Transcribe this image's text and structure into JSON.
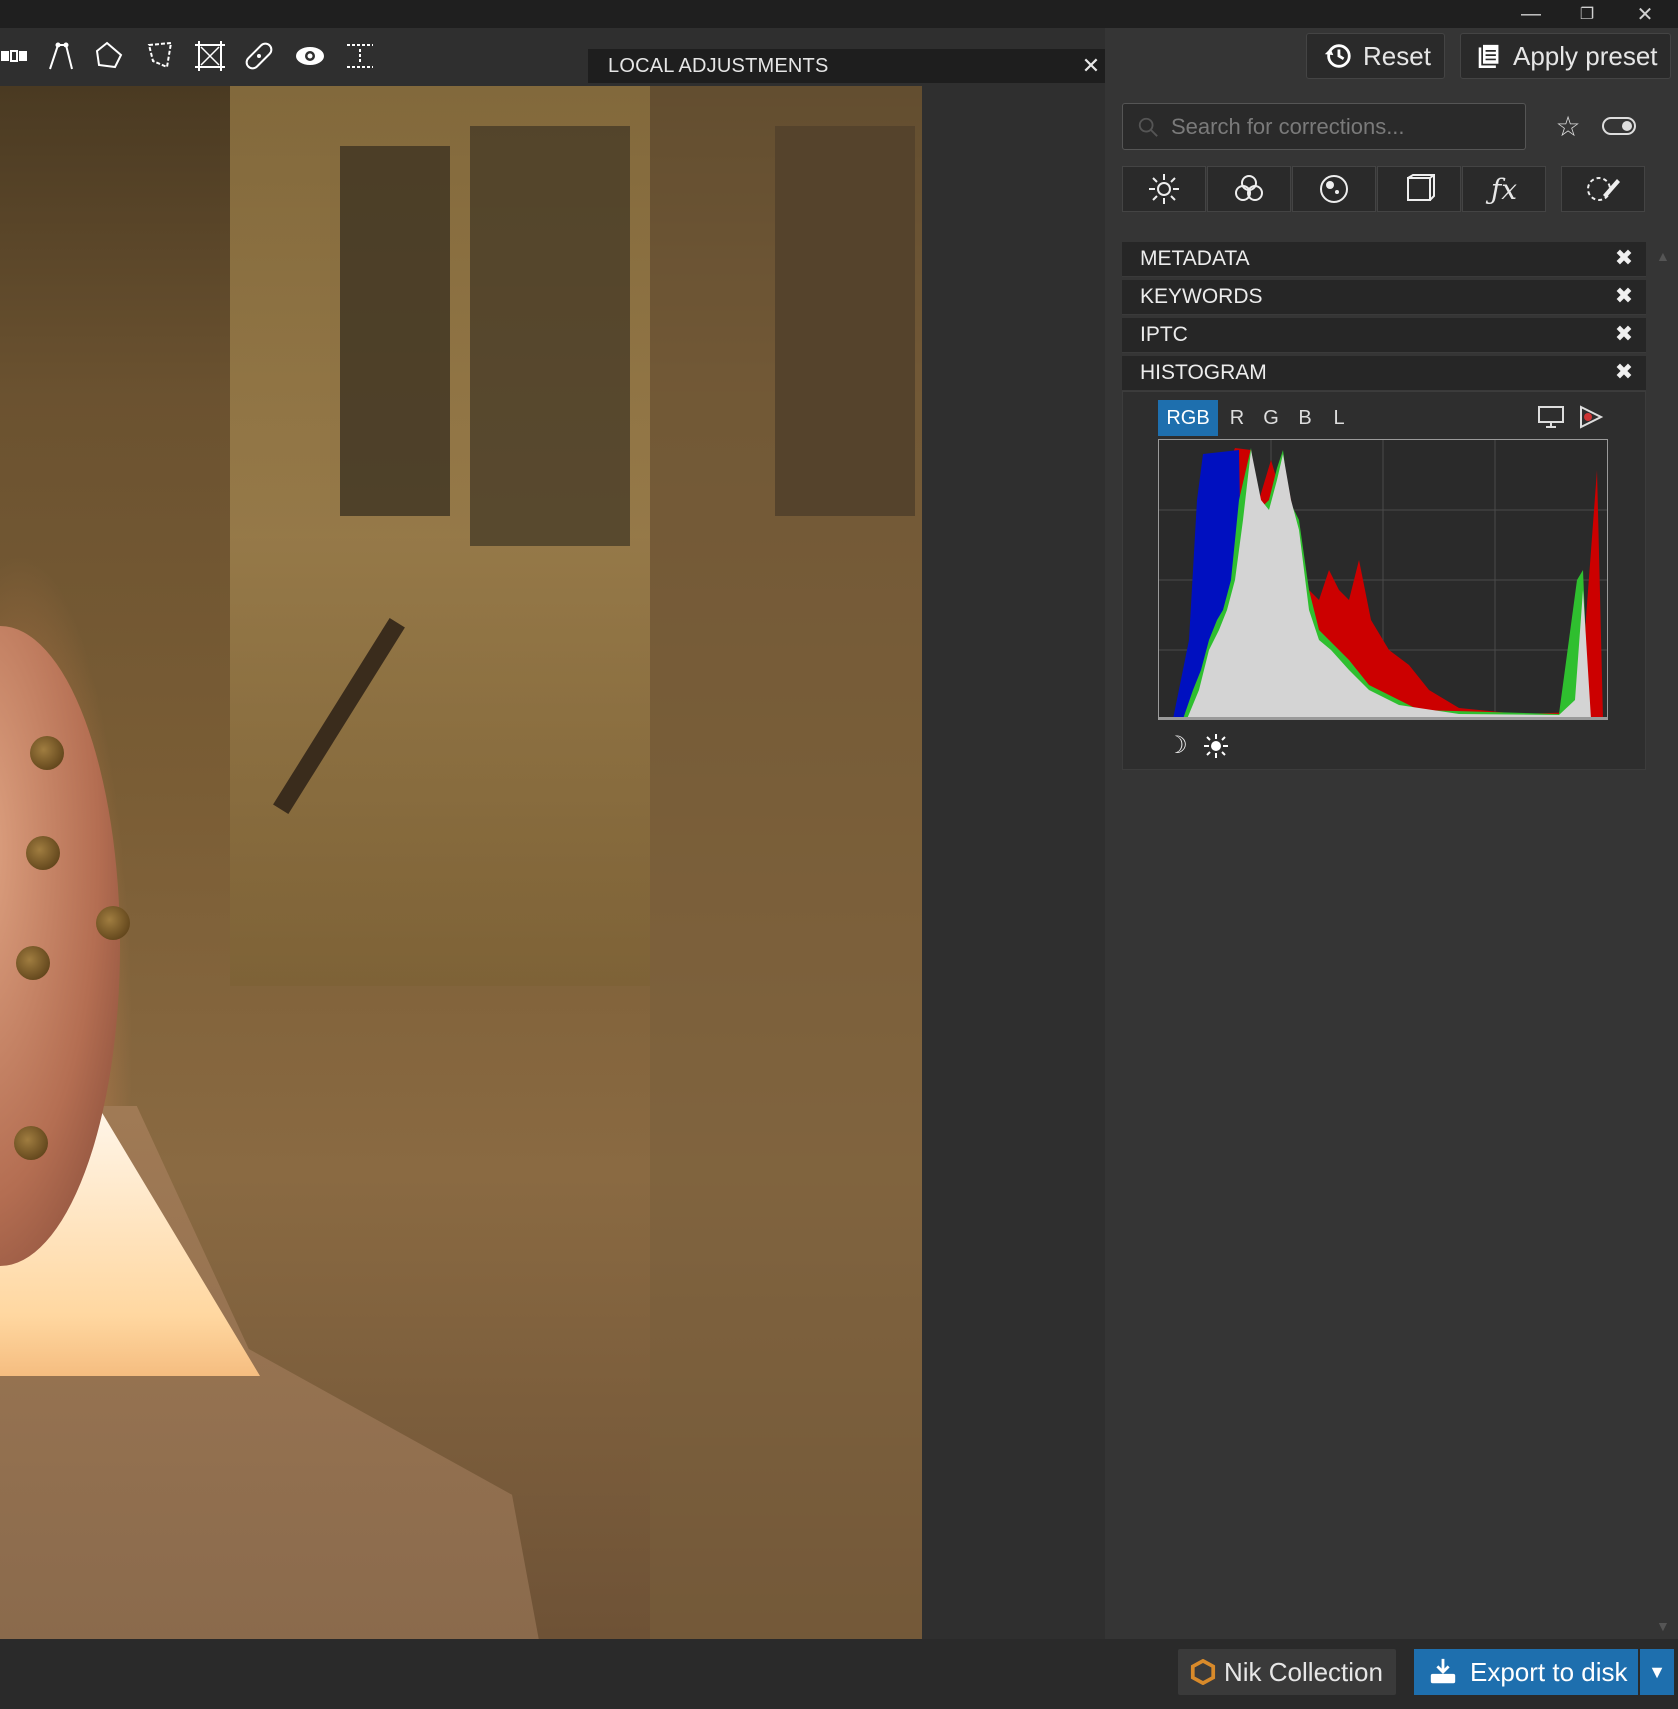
{
  "window": {
    "minimize_icon": "minimize-icon",
    "restore_icon": "restore-icon",
    "close_icon": "close-icon"
  },
  "toolbar": {
    "tools": [
      "compare-icon",
      "control-line-icon",
      "polygon-icon",
      "lasso-icon",
      "crop-icon",
      "repair-icon",
      "eye-icon",
      "guides-icon"
    ]
  },
  "local_adjustments": {
    "title": "LOCAL ADJUSTMENTS"
  },
  "header_buttons": {
    "reset_label": "Reset",
    "apply_preset_label": "Apply preset"
  },
  "search": {
    "placeholder": "Search for corrections..."
  },
  "categories": [
    "light-icon",
    "color-icon",
    "detail-icon",
    "geometry-icon",
    "effects-icon",
    "local-icon"
  ],
  "sections": {
    "metadata": "METADATA",
    "keywords": "KEYWORDS",
    "iptc": "IPTC",
    "histogram": "HISTOGRAM"
  },
  "histogram": {
    "channels": [
      "RGB",
      "R",
      "G",
      "B",
      "L"
    ],
    "selected_channel": "RGB",
    "colors": {
      "red": "#cc0000",
      "green": "#2fbf2f",
      "blue": "#0010c0",
      "luminance": "#d4d4d4",
      "cyan": "#20c0c0"
    }
  },
  "bottom": {
    "nik_label": "Nik Collection",
    "export_label": "Export to disk"
  },
  "colors": {
    "accent": "#1e6fae",
    "panel": "#353535"
  }
}
